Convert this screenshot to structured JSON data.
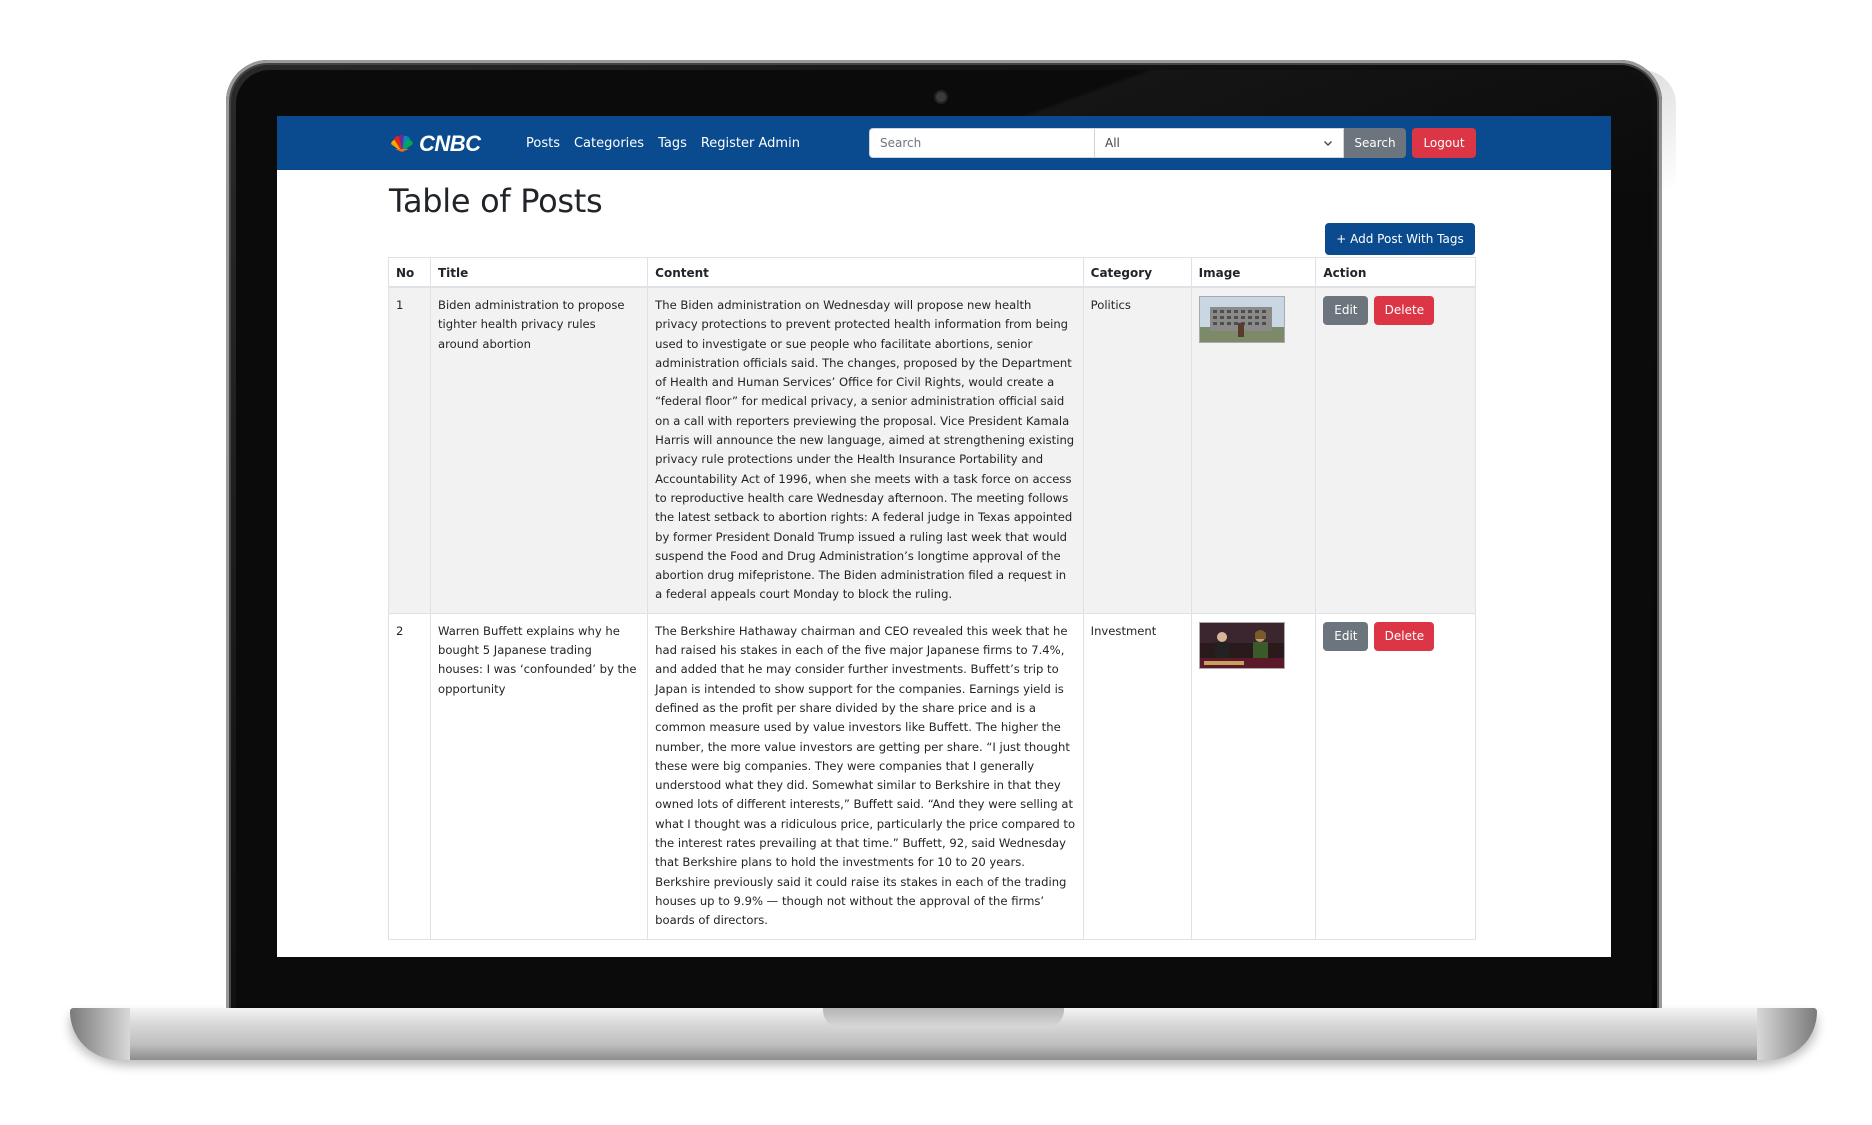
{
  "brand": {
    "logo_text": "CNBC"
  },
  "navbar": {
    "links": [
      "Posts",
      "Categories",
      "Tags",
      "Register Admin"
    ],
    "search_placeholder": "Search",
    "filter_selected": "All",
    "search_button": "Search",
    "logout_button": "Logout",
    "bg_color": "#0a4b8f"
  },
  "page": {
    "title": "Table of Posts",
    "add_button": "+ Add Post With Tags"
  },
  "table": {
    "columns": [
      "No",
      "Title",
      "Content",
      "Category",
      "Image",
      "Action"
    ],
    "rows": [
      {
        "no": "1",
        "title": "Biden administration to propose tighter health privacy rules around abortion",
        "content": "The Biden administration on Wednesday will propose new health privacy protections to prevent protected health information from being used to investigate or sue people who facilitate abortions, senior administration officials said. The changes, proposed by the Department of Health and Human Services’ Office for Civil Rights, would create a “federal floor” for medical privacy, a senior administration official said on a call with reporters previewing the proposal. Vice President Kamala Harris will announce the new language, aimed at strengthening existing privacy rule protections under the Health Insurance Portability and Accountability Act of 1996, when she meets with a task force on access to reproductive health care Wednesday afternoon. The meeting follows the latest setback to abortion rights: A federal judge in Texas appointed by former President Donald Trump issued a ruling last week that would suspend the Food and Drug Administration’s longtime approval of the abortion drug mifepristone. The Biden administration filed a request in a federal appeals court Monday to block the ruling.",
        "category": "Politics",
        "image_icon": "building-photo",
        "edit": "Edit",
        "delete": "Delete"
      },
      {
        "no": "2",
        "title": "Warren Buffett explains why he bought 5 Japanese trading houses: I was ‘confounded’ by the opportunity",
        "content": "The Berkshire Hathaway chairman and CEO revealed this week that he had raised his stakes in each of the five major Japanese firms to 7.4%, and added that he may consider further investments. Buffett’s trip to Japan is intended to show support for the companies. Earnings yield is defined as the profit per share divided by the share price and is a common measure used by value investors like Buffett. The higher the number, the more value investors are getting per share. “I just thought these were big companies. They were companies that I generally understood what they did. Somewhat similar to Berkshire in that they owned lots of different interests,” Buffett said. “And they were selling at what I thought was a ridiculous price, particularly the price compared to the interest rates prevailing at that time.” Buffett, 92, said Wednesday that Berkshire plans to hold the investments for 10 to 20 years. Berkshire previously said it could raise its stakes in each of the trading houses up to 9.9% — though not without the approval of the firms’ boards of directors.",
        "category": "Investment",
        "image_icon": "interview-photo",
        "edit": "Edit",
        "delete": "Delete"
      }
    ]
  }
}
